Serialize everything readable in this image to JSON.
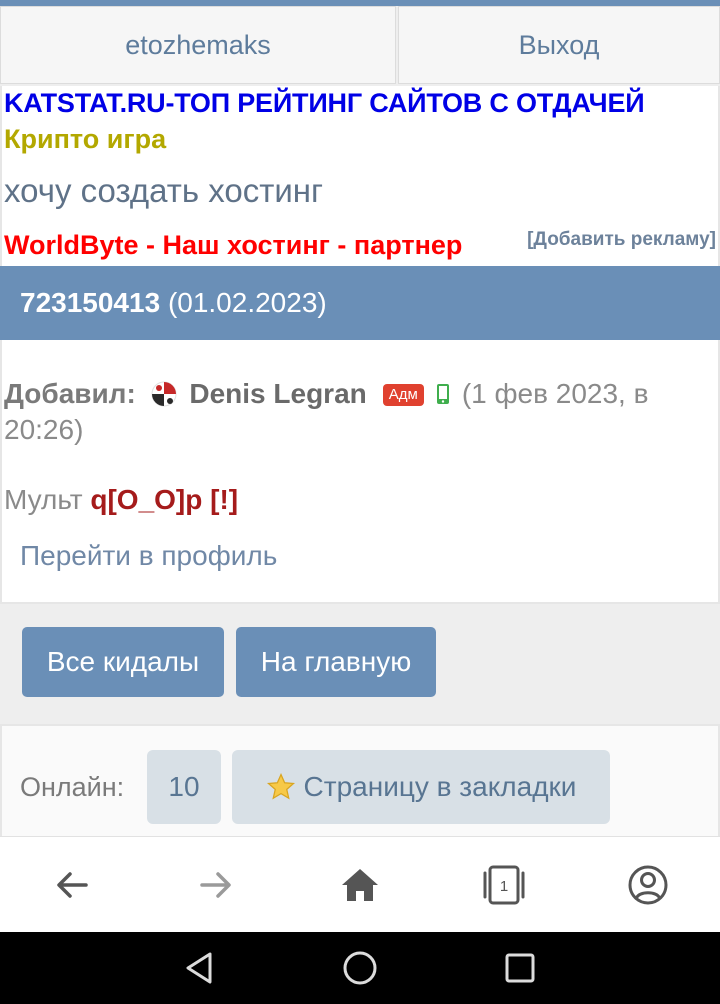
{
  "topbar": {
    "user_label": "etozhemaks",
    "exit_label": "Выход"
  },
  "ads": {
    "line1": "KATSTAT.RU-ТОП РЕЙТИНГ САЙТОВ С ОТДАЧЕЙ",
    "line2": "Крипто игра",
    "line3": "хочу создать хостинг",
    "line4": "WorldByte - Наш хостинг - партнер",
    "add_ad": "[Добавить рекламу]"
  },
  "post": {
    "id": "723150413",
    "date": "(01.02.2023)",
    "added_label": "Добавил:",
    "author": "Denis Legran",
    "role_badge": "Адм",
    "timestamp": "(1 фев 2023, в 20:26)",
    "mult_label": "Мульт",
    "mult_value": "q[O_O]p",
    "mult_flag": "[!]",
    "profile_link": "Перейти в профиль"
  },
  "buttons": {
    "all_scammers": "Все кидалы",
    "home": "На главную"
  },
  "online": {
    "label": "Онлайн:",
    "count": "10",
    "bookmark": "Страницу в закладки"
  },
  "browser_nav": {
    "icons": [
      "back-arrow-icon",
      "forward-arrow-icon",
      "home-icon",
      "tabs-icon",
      "account-icon"
    ],
    "tab_count": "1"
  },
  "system_nav": {
    "icons": [
      "back-triangle-icon",
      "home-circle-icon",
      "recents-square-icon"
    ]
  },
  "colors": {
    "accent": "#6a8fb7",
    "ad_blue": "#0000e6",
    "ad_yellow": "#b3a800",
    "ad_red": "#ff0000",
    "badge_red": "#e0412f",
    "mult_red": "#a51b1b"
  }
}
